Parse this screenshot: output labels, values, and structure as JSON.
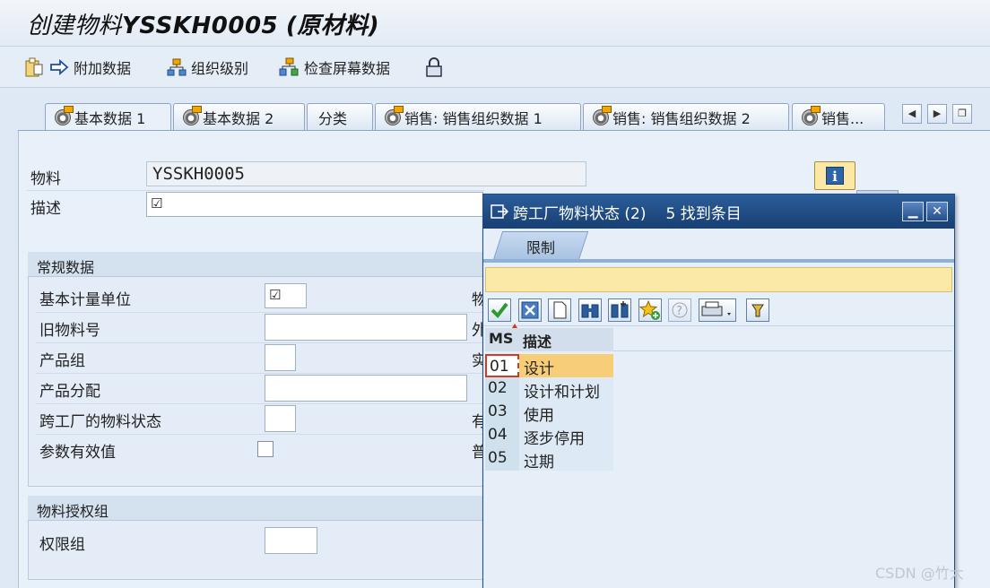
{
  "title": {
    "main": "创建物料",
    "code": "YSSKH0005",
    "suffix": "(原材料)"
  },
  "toolbar": {
    "additional_data": "附加数据",
    "org_levels": "组织级别",
    "check_screen_data": "检查屏幕数据"
  },
  "tabs": [
    {
      "label": "基本数据 1",
      "icon": "status-icon"
    },
    {
      "label": "基本数据 2",
      "icon": "status-icon"
    },
    {
      "label": "分类"
    },
    {
      "label": "销售: 销售组织数据 1",
      "icon": "status-icon"
    },
    {
      "label": "销售: 销售组织数据 2",
      "icon": "status-icon"
    },
    {
      "label": "销售...",
      "icon": "status-icon"
    }
  ],
  "header_fields": {
    "material_label": "物料",
    "material_value": "YSSKH0005",
    "description_label": "描述"
  },
  "general_group": {
    "title": "常规数据",
    "base_uom": "基本计量单位",
    "old_material_no": "旧物料号",
    "product_group": "产品组",
    "product_allocation": "产品分配",
    "cross_plant_status": "跨工厂的物料状态",
    "param_effectivity": "参数有效值",
    "right_column_clipped": [
      "物",
      "外",
      "实",
      "有",
      "普"
    ]
  },
  "auth_group": {
    "title": "物料授权组",
    "auth_group_label": "权限组"
  },
  "popup": {
    "title": "跨工厂物料状态 (2)",
    "found": "5 找到条目",
    "restrict_tab": "限制",
    "columns": {
      "ms": "MS",
      "desc": "描述"
    },
    "rows": [
      {
        "code": "01",
        "desc": "设计",
        "selected": true
      },
      {
        "code": "02",
        "desc": "设计和计划"
      },
      {
        "code": "03",
        "desc": "使用"
      },
      {
        "code": "04",
        "desc": "逐步停用"
      },
      {
        "code": "05",
        "desc": "过期"
      }
    ]
  },
  "watermark": "CSDN @竹大",
  "colors": {
    "title_bar": "#173f73",
    "selected_row": "#f8cd77",
    "yellow_bar": "#fbe9a8"
  }
}
